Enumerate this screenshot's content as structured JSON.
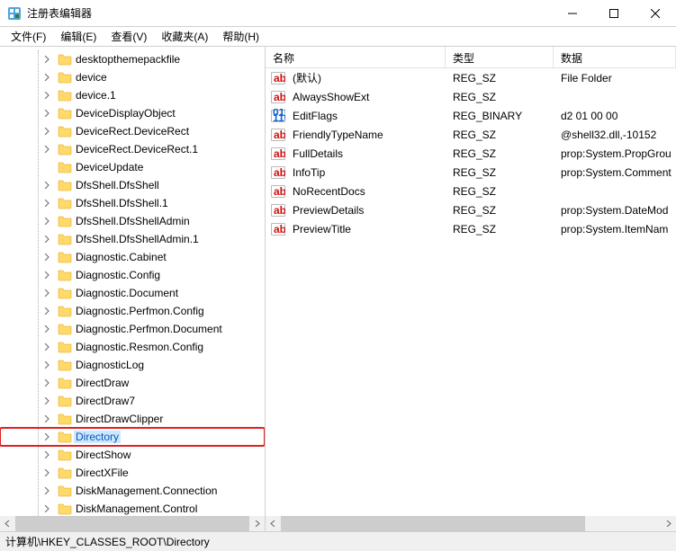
{
  "window": {
    "title": "注册表编辑器"
  },
  "menu": {
    "file": "文件(F)",
    "edit": "编辑(E)",
    "view": "查看(V)",
    "favorites": "收藏夹(A)",
    "help": "帮助(H)"
  },
  "tree": {
    "items": [
      {
        "label": "desktopthemepackfile",
        "hasChildren": true
      },
      {
        "label": "device",
        "hasChildren": true
      },
      {
        "label": "device.1",
        "hasChildren": true
      },
      {
        "label": "DeviceDisplayObject",
        "hasChildren": true
      },
      {
        "label": "DeviceRect.DeviceRect",
        "hasChildren": true
      },
      {
        "label": "DeviceRect.DeviceRect.1",
        "hasChildren": true
      },
      {
        "label": "DeviceUpdate",
        "hasChildren": false
      },
      {
        "label": "DfsShell.DfsShell",
        "hasChildren": true
      },
      {
        "label": "DfsShell.DfsShell.1",
        "hasChildren": true
      },
      {
        "label": "DfsShell.DfsShellAdmin",
        "hasChildren": true
      },
      {
        "label": "DfsShell.DfsShellAdmin.1",
        "hasChildren": true
      },
      {
        "label": "Diagnostic.Cabinet",
        "hasChildren": true
      },
      {
        "label": "Diagnostic.Config",
        "hasChildren": true
      },
      {
        "label": "Diagnostic.Document",
        "hasChildren": true
      },
      {
        "label": "Diagnostic.Perfmon.Config",
        "hasChildren": true
      },
      {
        "label": "Diagnostic.Perfmon.Document",
        "hasChildren": true
      },
      {
        "label": "Diagnostic.Resmon.Config",
        "hasChildren": true
      },
      {
        "label": "DiagnosticLog",
        "hasChildren": true
      },
      {
        "label": "DirectDraw",
        "hasChildren": true
      },
      {
        "label": "DirectDraw7",
        "hasChildren": true
      },
      {
        "label": "DirectDrawClipper",
        "hasChildren": true
      },
      {
        "label": "Directory",
        "hasChildren": true,
        "selected": true,
        "highlighted": true
      },
      {
        "label": "DirectShow",
        "hasChildren": true
      },
      {
        "label": "DirectXFile",
        "hasChildren": true
      },
      {
        "label": "DiskManagement.Connection",
        "hasChildren": true
      },
      {
        "label": "DiskManagement.Control",
        "hasChildren": true
      }
    ]
  },
  "list": {
    "columns": {
      "name": "名称",
      "type": "类型",
      "data": "数据"
    },
    "rows": [
      {
        "icon": "str",
        "name": "(默认)",
        "type": "REG_SZ",
        "data": "File Folder"
      },
      {
        "icon": "str",
        "name": "AlwaysShowExt",
        "type": "REG_SZ",
        "data": ""
      },
      {
        "icon": "bin",
        "name": "EditFlags",
        "type": "REG_BINARY",
        "data": "d2 01 00 00"
      },
      {
        "icon": "str",
        "name": "FriendlyTypeName",
        "type": "REG_SZ",
        "data": "@shell32.dll,-10152"
      },
      {
        "icon": "str",
        "name": "FullDetails",
        "type": "REG_SZ",
        "data": "prop:System.PropGrou"
      },
      {
        "icon": "str",
        "name": "InfoTip",
        "type": "REG_SZ",
        "data": "prop:System.Comment"
      },
      {
        "icon": "str",
        "name": "NoRecentDocs",
        "type": "REG_SZ",
        "data": ""
      },
      {
        "icon": "str",
        "name": "PreviewDetails",
        "type": "REG_SZ",
        "data": "prop:System.DateMod"
      },
      {
        "icon": "str",
        "name": "PreviewTitle",
        "type": "REG_SZ",
        "data": "prop:System.ItemNam"
      }
    ]
  },
  "statusbar": {
    "path": "计算机\\HKEY_CLASSES_ROOT\\Directory"
  }
}
